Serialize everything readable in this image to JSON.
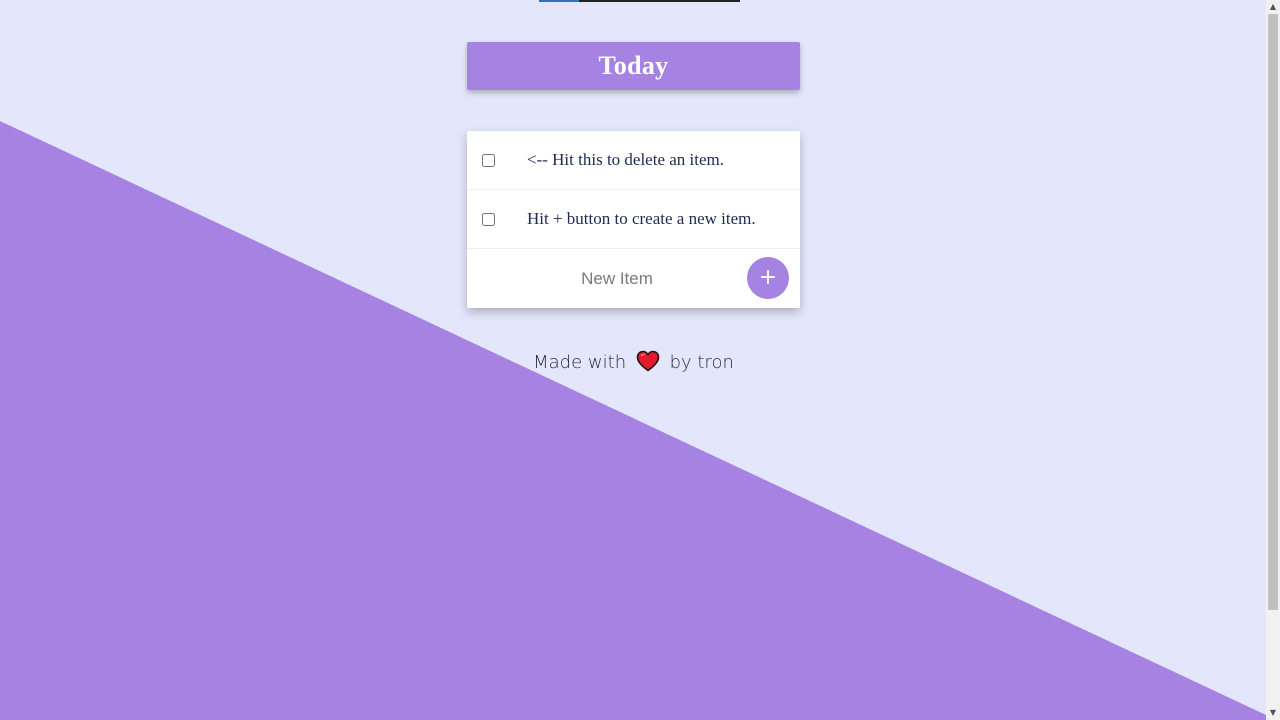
{
  "heading": {
    "title": "Today"
  },
  "list": {
    "items": [
      {
        "text": "<-- Hit this to delete an item.",
        "checked": false
      },
      {
        "text": "Hit + button to create a new item.",
        "checked": false
      }
    ],
    "new_item": {
      "placeholder": "New Item",
      "value": "",
      "add_label": "+"
    }
  },
  "footer": {
    "prefix": "Made with",
    "icon": "heart-icon",
    "suffix": "by tron"
  },
  "colors": {
    "background": "#e4e7fb",
    "accent": "#a683e3",
    "text": "#1e2a52",
    "heart": "#e21a2c"
  },
  "scrollbar": {
    "up_icon": "scroll-up-arrow-icon",
    "down_icon": "scroll-down-arrow-icon"
  }
}
